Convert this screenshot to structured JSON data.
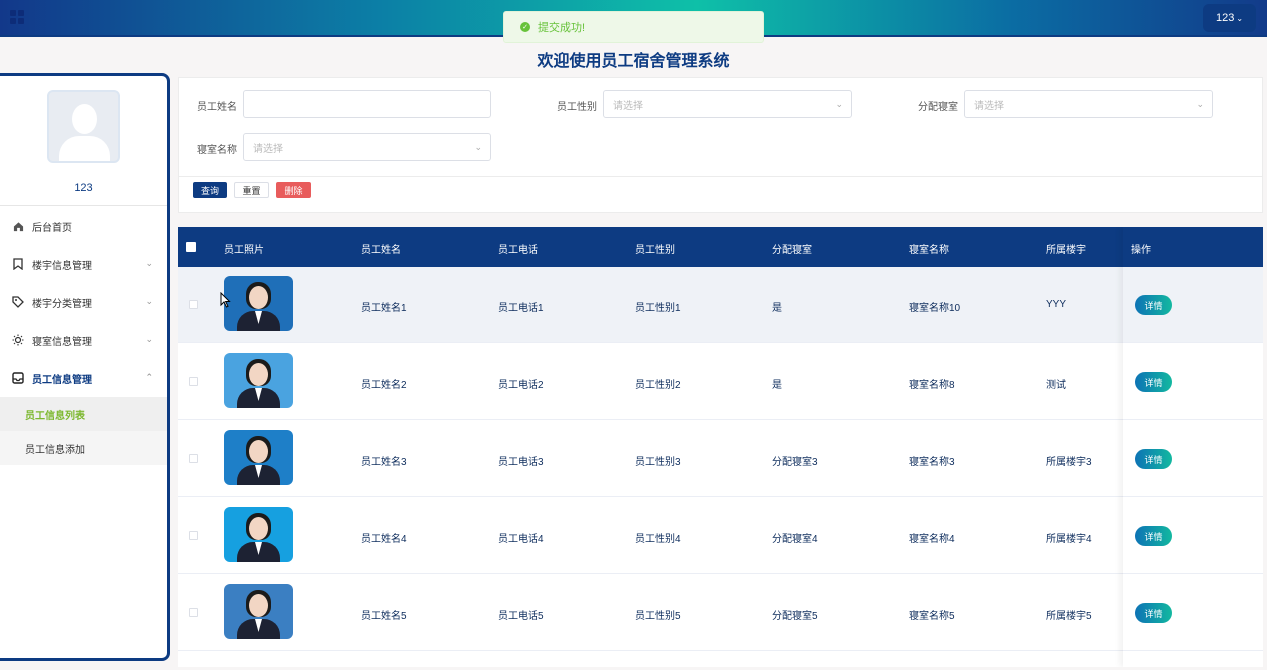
{
  "header": {
    "user_button_label": "123",
    "user_button_chevron": "⌄"
  },
  "toast": {
    "message": "提交成功!",
    "color": "#67c23a"
  },
  "page_title": "欢迎使用员工宿舍管理系统",
  "sidebar": {
    "username": "123",
    "menu": [
      {
        "label": "后台首页",
        "icon": "home-icon",
        "expandable": false
      },
      {
        "label": "楼宇信息管理",
        "icon": "bookmark-icon",
        "expandable": true
      },
      {
        "label": "楼宇分类管理",
        "icon": "tag-icon",
        "expandable": true
      },
      {
        "label": "寝室信息管理",
        "icon": "sun-icon",
        "expandable": true
      },
      {
        "label": "员工信息管理",
        "icon": "inbox-icon",
        "expandable": true,
        "open": true
      }
    ],
    "submenu": [
      {
        "label": "员工信息列表",
        "current": true
      },
      {
        "label": "员工信息添加",
        "current": false
      }
    ]
  },
  "search": {
    "name_label": "员工姓名",
    "name_value": "",
    "gender_label": "员工性别",
    "gender_placeholder": "请选择",
    "assign_label": "分配寝室",
    "assign_placeholder": "请选择",
    "room_label": "寝室名称",
    "room_placeholder": "请选择",
    "query_button": "查询",
    "reset_button": "重置",
    "delete_button": "删除"
  },
  "table": {
    "columns": [
      "员工照片",
      "员工姓名",
      "员工电话",
      "员工性别",
      "分配寝室",
      "寝室名称",
      "所属楼宇",
      "操作"
    ],
    "detail_button": "详情",
    "rows": [
      {
        "name": "员工姓名1",
        "phone": "员工电话1",
        "gender": "员工性别1",
        "assigned": "是",
        "room": "寝室名称10",
        "building": "YYY",
        "photo_bg": "#1f6fb8"
      },
      {
        "name": "员工姓名2",
        "phone": "员工电话2",
        "gender": "员工性别2",
        "assigned": "是",
        "room": "寝室名称8",
        "building": "测试",
        "photo_bg": "#4aa3e0"
      },
      {
        "name": "员工姓名3",
        "phone": "员工电话3",
        "gender": "员工性别3",
        "assigned": "分配寝室3",
        "room": "寝室名称3",
        "building": "所属楼宇3",
        "photo_bg": "#1e7fc8"
      },
      {
        "name": "员工姓名4",
        "phone": "员工电话4",
        "gender": "员工性别4",
        "assigned": "分配寝室4",
        "room": "寝室名称4",
        "building": "所属楼宇4",
        "photo_bg": "#16a0e0"
      },
      {
        "name": "员工姓名5",
        "phone": "员工电话5",
        "gender": "员工性别5",
        "assigned": "分配寝室5",
        "room": "寝室名称5",
        "building": "所属楼宇5",
        "photo_bg": "#3b7fc2"
      }
    ]
  },
  "colors": {
    "brand": "#0d3b82",
    "accent_green": "#7cb82f",
    "danger": "#e85c5c"
  }
}
